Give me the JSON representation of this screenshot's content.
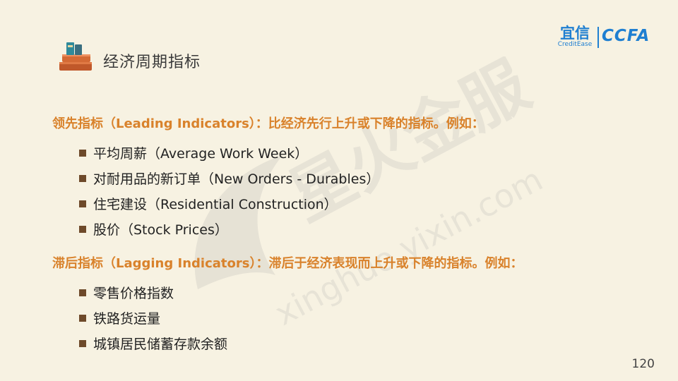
{
  "header": {
    "title": "经济周期指标",
    "logo_yixin_cn": "宜信",
    "logo_yixin_en": "CreditEase",
    "logo_ccfa": "CCFA"
  },
  "watermark": {
    "cn": "星火金服",
    "url": "xinghuo.yixin.com"
  },
  "leading": {
    "heading": "领先指标（Leading Indicators）：比经济先行上升或下降的指标。例如：",
    "items": [
      "平均周薪（Average Work Week）",
      "对耐用品的新订单（New Orders - Durables）",
      "住宅建设（Residential Construction）",
      "股价（Stock Prices）"
    ]
  },
  "lagging": {
    "heading": "滞后指标（Lagging Indicators）：滞后于经济表现而上升或下降的指标。例如：",
    "items": [
      "零售价格指数",
      "铁路货运量",
      "城镇居民储蓄存款余额"
    ]
  },
  "footer": {
    "page_number": "120"
  },
  "colors": {
    "background": "#f7f2e2",
    "heading_orange": "#d9822b",
    "bullet_brown": "#6e4a2a",
    "brand_blue": "#1f7fd1"
  }
}
